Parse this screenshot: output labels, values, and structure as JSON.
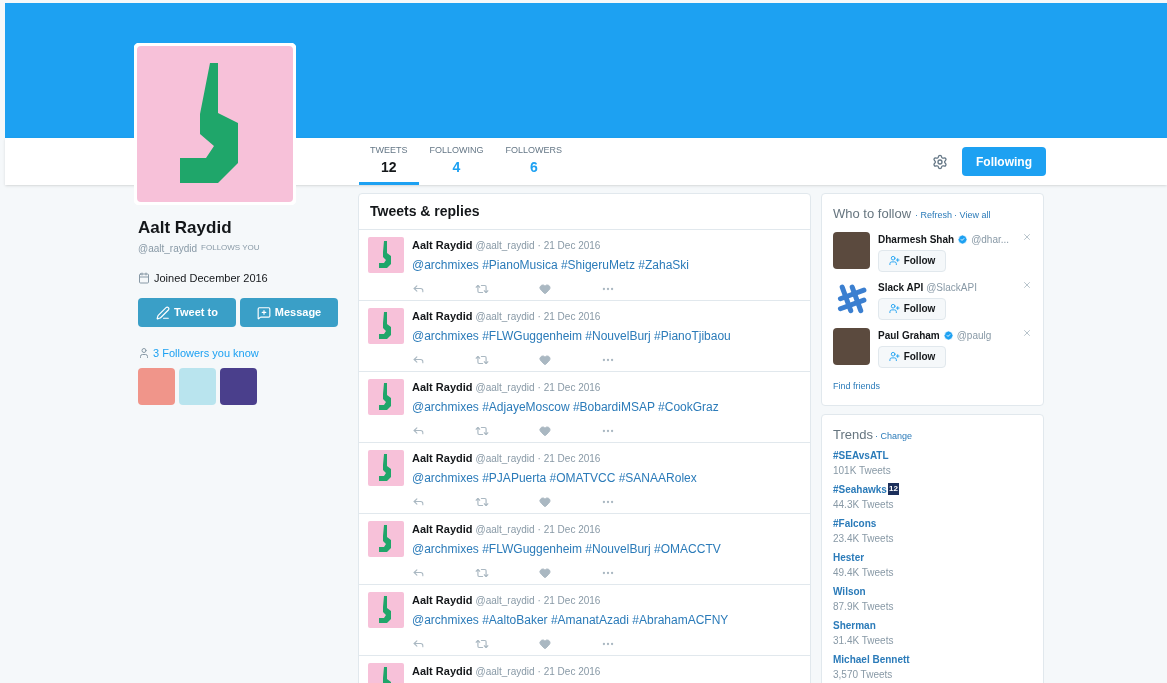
{
  "profile": {
    "name": "Aalt Raydid",
    "handle": "@aalt_raydid",
    "follows_you": "FOLLOWS YOU",
    "joined": "Joined December 2016",
    "buttons": [
      "Tweet to",
      "Message"
    ],
    "followers_you_know": "3 Followers you know"
  },
  "tabs": [
    {
      "label": "TWEETS",
      "count": "12",
      "selected": true
    },
    {
      "label": "FOLLOWING",
      "count": "4",
      "selected": false
    },
    {
      "label": "FOLLOWERS",
      "count": "6",
      "selected": false
    }
  ],
  "follow_button": "Following",
  "timeline": {
    "title": "Tweets & replies",
    "tweets": [
      {
        "name": "Aalt Raydid",
        "handle": "@aalt_raydid",
        "date": "· 21 Dec 2016",
        "text": "@archmixes #PianoMusica #ShigeruMetz #ZahaSki"
      },
      {
        "name": "Aalt Raydid",
        "handle": "@aalt_raydid",
        "date": "· 21 Dec 2016",
        "text": "@archmixes #FLWGuggenheim #NouvelBurj #PianoTjibaou"
      },
      {
        "name": "Aalt Raydid",
        "handle": "@aalt_raydid",
        "date": "· 21 Dec 2016",
        "text": "@archmixes #AdjayeMoscow #BobardiMSAP #CookGraz"
      },
      {
        "name": "Aalt Raydid",
        "handle": "@aalt_raydid",
        "date": "· 21 Dec 2016",
        "text": "@archmixes #PJAPuerta #OMATVCC #SANAARolex"
      },
      {
        "name": "Aalt Raydid",
        "handle": "@aalt_raydid",
        "date": "· 21 Dec 2016",
        "text": "@archmixes #FLWGuggenheim #NouvelBurj #OMACCTV"
      },
      {
        "name": "Aalt Raydid",
        "handle": "@aalt_raydid",
        "date": "· 21 Dec 2016",
        "text": "@archmixes #AaltoBaker #AmanatAzadi #AbrahamACFNY"
      },
      {
        "name": "Aalt Raydid",
        "handle": "@aalt_raydid",
        "date": "· 21 Dec 2016"
      }
    ]
  },
  "who_to_follow": {
    "title": "Who to follow",
    "refresh": "· Refresh",
    "view_all": "· View all",
    "find_friends": "Find friends",
    "accounts": [
      {
        "name": "Dharmesh Shah",
        "verified": true,
        "handle": "@dhar...",
        "kind": "photo",
        "button": "Follow"
      },
      {
        "name": "Slack API",
        "verified": false,
        "handle": "@SlackAPI",
        "kind": "logo",
        "button": "Follow"
      },
      {
        "name": "Paul Graham",
        "verified": true,
        "handle": "@paulg",
        "kind": "photo",
        "button": "Follow"
      }
    ]
  },
  "trends": {
    "title": "Trends",
    "change": "· Change",
    "items": [
      {
        "tag": "#SEAvsATL",
        "count": "101K Tweets"
      },
      {
        "tag": "#Seahawks",
        "badge": "12",
        "count": "44.3K Tweets"
      },
      {
        "tag": "#Falcons",
        "count": "23.4K Tweets"
      },
      {
        "tag": "Hester",
        "count": "49.4K Tweets"
      },
      {
        "tag": "Wilson",
        "count": "87.9K Tweets"
      },
      {
        "tag": "Sherman",
        "count": "31.4K Tweets"
      },
      {
        "tag": "Michael Bennett",
        "count": "3,570 Tweets"
      }
    ]
  }
}
